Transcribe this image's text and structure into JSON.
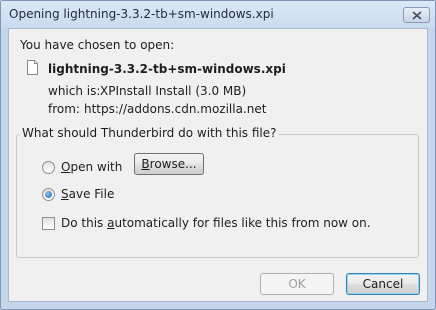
{
  "window": {
    "title": "Opening lightning-3.3.2-tb+sm-windows.xpi"
  },
  "dialog": {
    "intro": "You have chosen to open:",
    "filename": "lightning-3.3.2-tb+sm-windows.xpi",
    "which_is_label": "which is:",
    "which_is_value": "XPInstall Install (3.0 MB)",
    "from_label": "from:",
    "from_value": "https://addons.cdn.mozilla.net"
  },
  "action_group": {
    "legend": "What should Thunderbird do with this file?",
    "open_with": {
      "mnemonic": "O",
      "rest": "pen with",
      "selected": false
    },
    "browse_button": {
      "mnemonic": "B",
      "rest": "rowse..."
    },
    "save_file": {
      "mnemonic": "S",
      "rest": "ave File",
      "selected": true
    },
    "auto_checkbox": {
      "before": "Do this ",
      "mnemonic": "a",
      "after": "utomatically for files like this from now on.",
      "checked": false
    }
  },
  "buttons": {
    "ok_label": "OK",
    "ok_enabled": false,
    "cancel_label": "Cancel"
  }
}
